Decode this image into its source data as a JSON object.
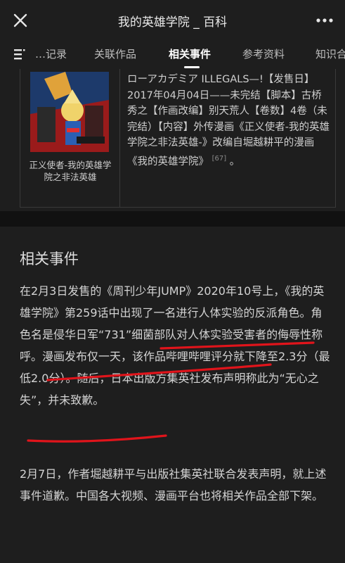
{
  "header": {
    "title": "我的英雄学院 _ 百科",
    "close_icon": "close-icon",
    "more_icon": "more-horizontal-icon"
  },
  "tabs": {
    "menu_icon": "list-icon",
    "items": [
      "…记录",
      "关联作品",
      "相关事件",
      "参考资料",
      "知识合"
    ],
    "active": "相关事件"
  },
  "card": {
    "cover_caption": "正义使者-我的英雄学院之非法英雄",
    "text_top_fragment": "ローアカデミア ILLEGALS—!【发",
    "text": "售日】2017年04月04日——未完结【脚本】古桥秀之【作画改编】别天荒人【卷数】4卷（未完结）【内容】外传漫画《正义使者-我的英雄学院之非法英雄-》改编自堀越耕平的漫画《我的英雄学院》",
    "citation": "[67]",
    "text_end": "。"
  },
  "section": {
    "title": "相关事件",
    "paragraph1": {
      "a": "在2月3日发售的《周刊少年JUMP》2020年10号上，《我的英雄学院》第259话中出现了一名进行人体实验的反派角色。",
      "b": "角色名是侵华日军“731”细菌部队对人体实验受害者的侮辱性称呼。",
      "c": "漫画发布仅一天，该作品哔哩哔哩评分就下降至2.3分（最低2.0分）。随后，日本出版方集英社发布声明称此为",
      "d": "“无心之失”，并未致歉。"
    },
    "paragraph2": "2月7日，作者堀越耕平与出版社集英社联合发表声明，就上述事件道歉。中国各大视频、漫画平台也将相关作品全部下架。"
  },
  "colors": {
    "background": "#1e1e1e",
    "separator": "#111111",
    "text": "#d4d4d4",
    "annotation": "#e0141b"
  }
}
